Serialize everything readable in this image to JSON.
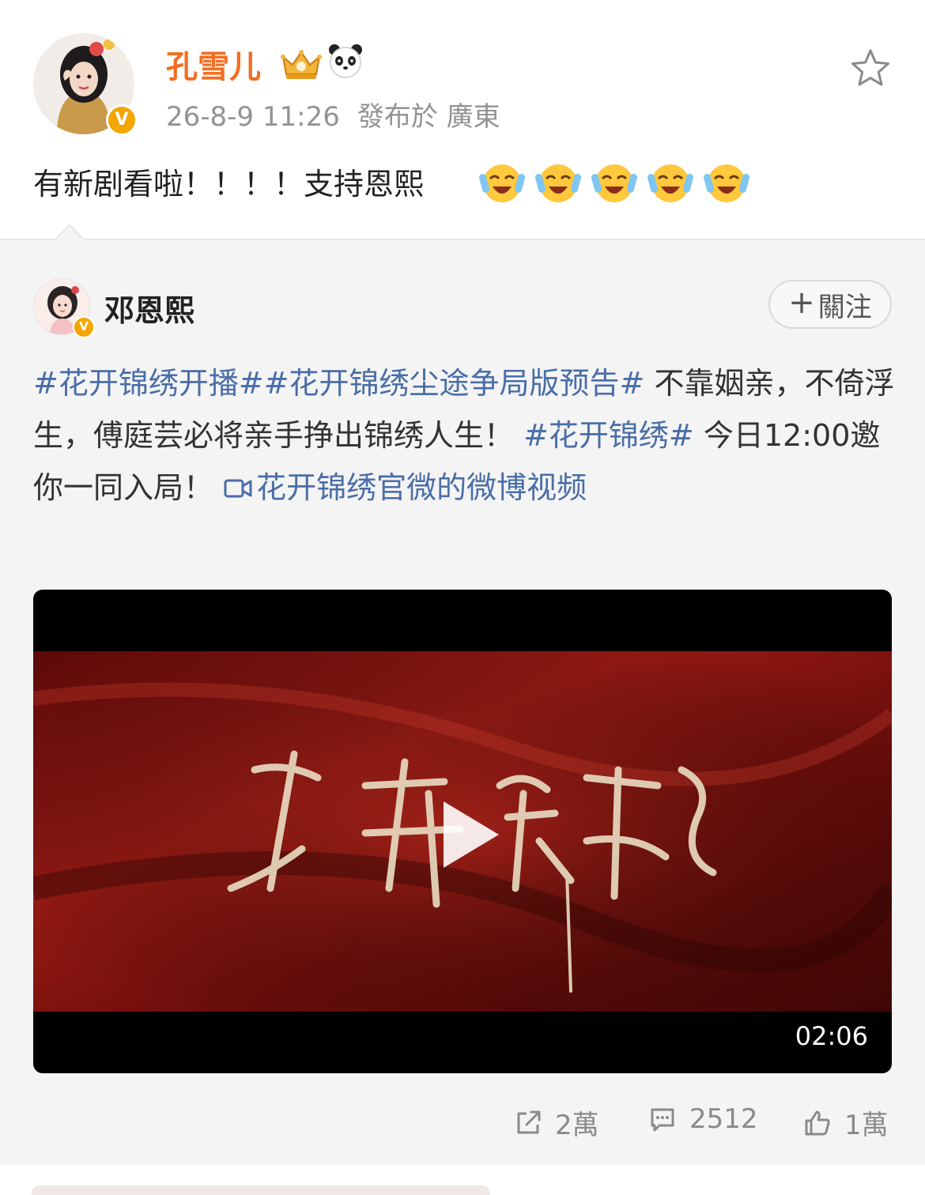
{
  "post": {
    "author": "孔雪儿",
    "timestamp": "26-8-9 11:26",
    "location": "發布於 廣東",
    "text": "有新剧看啦！！！！支持恩熙",
    "emojis": [
      "laugh-cry-emoji",
      "laugh-cry-emoji",
      "laugh-cry-emoji",
      "laugh-cry-emoji",
      "laugh-cry-emoji"
    ],
    "verified_badge": "V"
  },
  "repost": {
    "author": "邓恩熙",
    "verified_badge": "V",
    "follow_label": "關注",
    "follow_plus": "+",
    "tag1": "#花开锦绣开播#",
    "tag2": "#花开锦绣尘途争局版预告#",
    "text1": " 不靠姻亲，不倚浮生，傅庭芸必将亲手挣出锦绣人生！ ",
    "tag3": "#花开锦绣#",
    "text2": " 今日12:00邀你一同入局！ ",
    "video_link": "花开锦绣官微的微博视频"
  },
  "video": {
    "duration": "02:06"
  },
  "actions": {
    "share_count": "2萬",
    "comment_count": "2512",
    "like_count": "1萬"
  },
  "colors": {
    "author_orange": "#f26e22",
    "link_blue": "#4a6ea7",
    "verified_gold": "#f5a500",
    "meta_gray": "#939393",
    "card_bg": "#f4f4f4"
  }
}
